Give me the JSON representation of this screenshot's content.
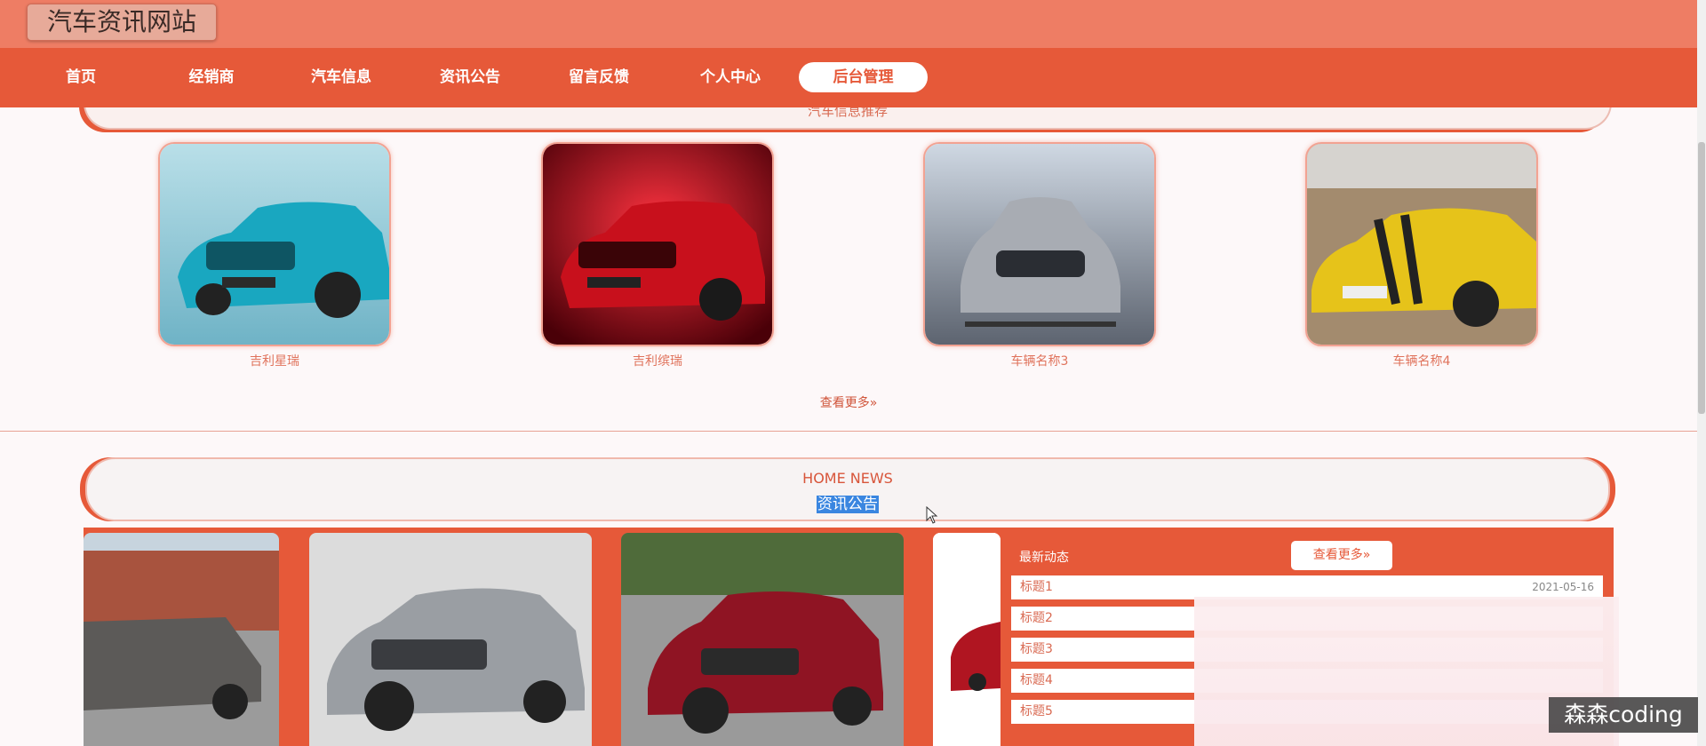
{
  "header": {
    "site_title": "汽车资讯网站"
  },
  "nav": {
    "items": [
      {
        "label": "首页"
      },
      {
        "label": "经销商"
      },
      {
        "label": "汽车信息"
      },
      {
        "label": "资讯公告"
      },
      {
        "label": "留言反馈"
      },
      {
        "label": "个人中心"
      },
      {
        "label": "后台管理",
        "active": true
      }
    ]
  },
  "car_section": {
    "banner_text": "汽车信息推荐",
    "cars": [
      {
        "name": "吉利星瑞"
      },
      {
        "name": "吉利缤瑞"
      },
      {
        "name": "车辆名称3"
      },
      {
        "name": "车辆名称4"
      }
    ],
    "more_label": "查看更多»"
  },
  "news_section": {
    "heading_en": "HOME NEWS",
    "heading_zh": "资讯公告",
    "latest_title": "最新动态",
    "more_label": "查看更多»",
    "items": [
      {
        "title": "标题1",
        "date": "2021-05-16"
      },
      {
        "title": "标题2"
      },
      {
        "title": "标题3"
      },
      {
        "title": "标题4"
      },
      {
        "title": "标题5"
      }
    ]
  },
  "watermark": "森森coding",
  "colors": {
    "primary": "#e65939",
    "header": "#ee7d64",
    "background": "#fdf8f9"
  }
}
